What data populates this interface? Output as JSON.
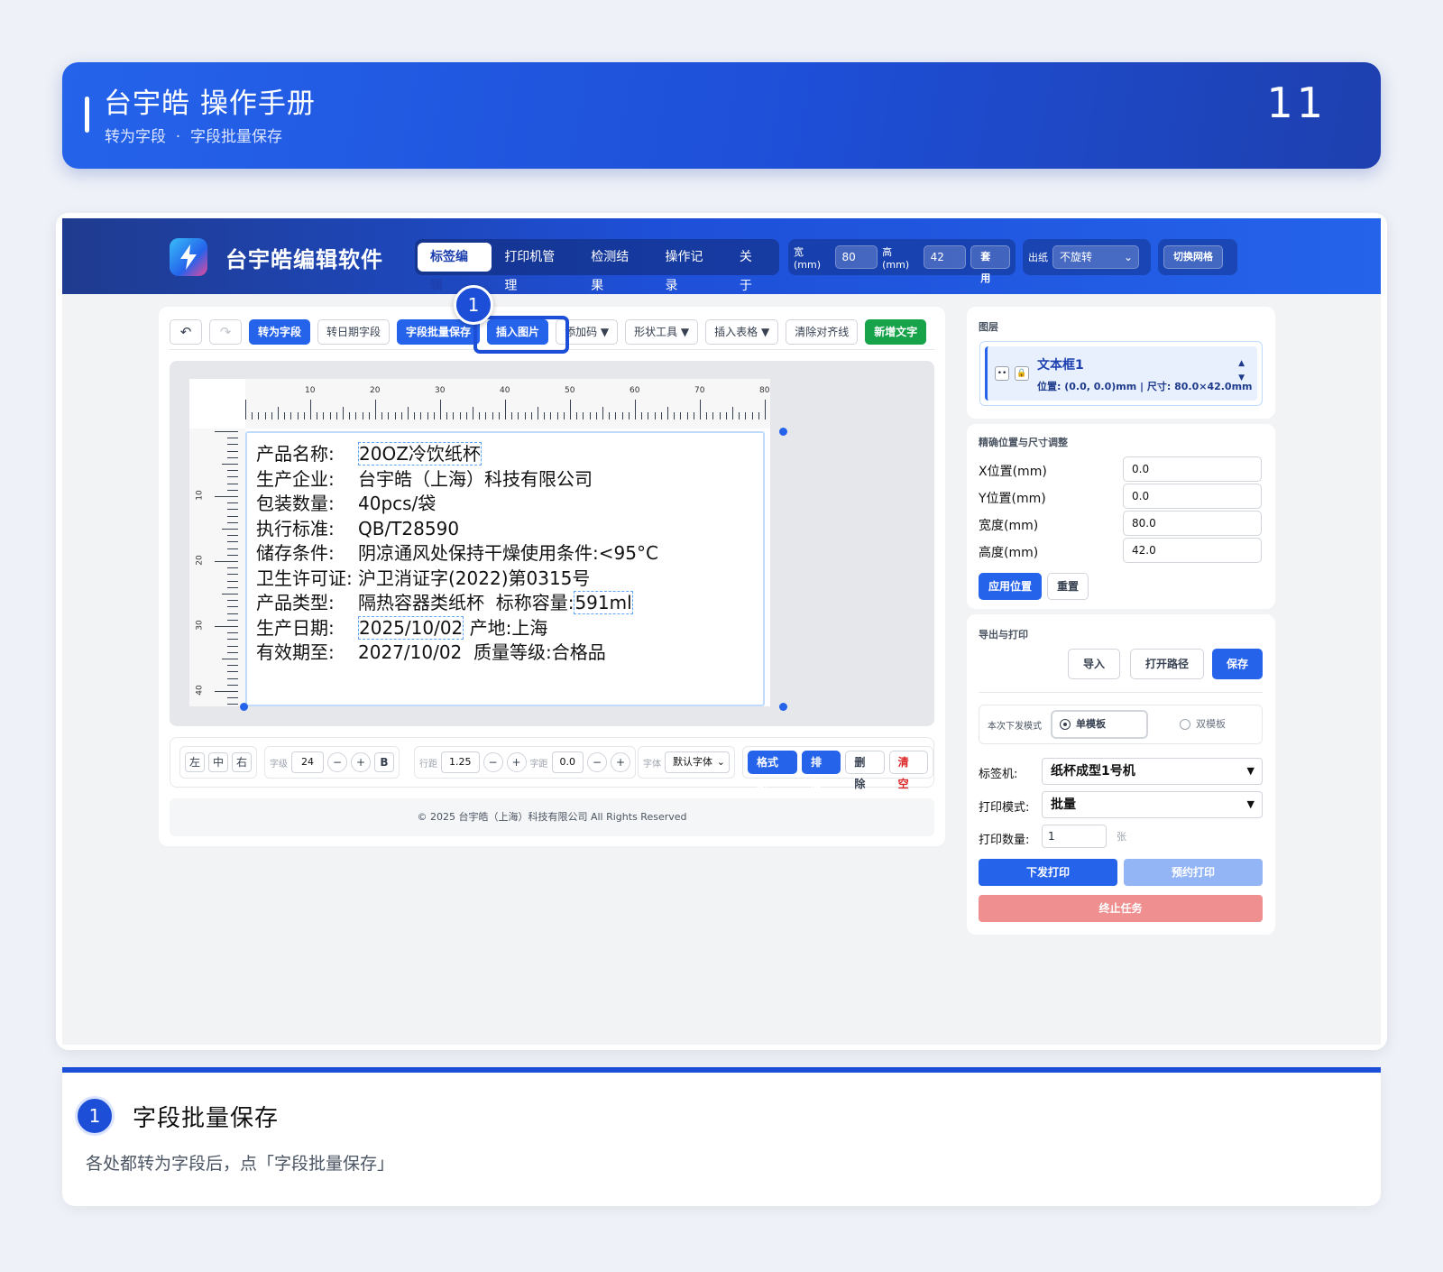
{
  "manual": {
    "title": "台宇皓 操作手册",
    "subtitle": "转为字段  ·  字段批量保存",
    "page_number": "11"
  },
  "app": {
    "name": "台宇皓编辑软件",
    "nav_tabs": [
      "标签编辑",
      "打印机管理",
      "检测结果",
      "操作记录",
      "关于"
    ],
    "active_tab": "标签编辑",
    "size": {
      "width_label": "宽(mm)",
      "width_value": "80",
      "height_label": "高(mm)",
      "height_value": "42",
      "apply_label": "套用"
    },
    "output": {
      "label": "出纸",
      "value": "不旋转"
    },
    "grid_button": "切换网格"
  },
  "toolbar": {
    "undo": "↶",
    "redo": "↷",
    "to_field": "转为字段",
    "to_date_field": "转日期字段",
    "batch_save": "字段批量保存",
    "insert_image": "插入图片",
    "add_code": "添加码 ▼",
    "shape_tools": "形状工具 ▼",
    "insert_table": "插入表格 ▼",
    "clear_guides": "清除对齐线",
    "add_text": "新增文字"
  },
  "callout": {
    "number": "1"
  },
  "ruler": {
    "top_labels": [
      "10",
      "20",
      "30",
      "40",
      "50",
      "60",
      "70",
      "80"
    ],
    "left_labels": [
      "10",
      "20",
      "30",
      "40"
    ]
  },
  "label": {
    "lines": [
      {
        "key": "产品名称:",
        "value": "20OZ冷饮纸杯",
        "field": true
      },
      {
        "key": "生产企业:",
        "value": "台宇皓（上海）科技有限公司"
      },
      {
        "key": "包装数量:",
        "value": "40pcs/袋"
      },
      {
        "key": "执行标准:",
        "value": "QB/T28590"
      },
      {
        "key": "储存条件:",
        "value": "阴凉通风处保持干燥使用条件:<95°C"
      },
      {
        "key": "卫生许可证:",
        "value": "沪卫消证字(2022)第0315号"
      },
      {
        "key": "产品类型:",
        "value": "隔热容器类纸杯  标称容量:",
        "tail": "591ml"
      },
      {
        "key": "生产日期:",
        "value": "2025/10/02",
        "field": true,
        "extra": " 产地:上海"
      },
      {
        "key": "有效期至:",
        "value": "2027/10/02  质量等级:合格品"
      }
    ]
  },
  "format_bar": {
    "align": [
      "左",
      "中",
      "右"
    ],
    "font_size_label": "字级",
    "font_size": "24",
    "minus": "−",
    "plus": "+",
    "bold": "B",
    "line_height_label": "行距",
    "line_height": "1.25",
    "spacing_label": "字距",
    "spacing": "0.0",
    "font_label": "字体",
    "font": "默认字体",
    "format_painter": "格式刷",
    "layout": "排版",
    "delete": "删除",
    "clear": "清空"
  },
  "footer": "© 2025 台宇皓（上海）科技有限公司 All Rights Reserved",
  "layers": {
    "title": "图层",
    "item_name": "文本框1",
    "item_meta": "位置: (0.0, 0.0)mm | 尺寸: 80.0×42.0mm",
    "up": "▲",
    "down": "▼"
  },
  "position": {
    "title": "精确位置与尺寸调整",
    "fields": [
      {
        "label": "X位置(mm)",
        "value": "0.0"
      },
      {
        "label": "Y位置(mm)",
        "value": "0.0"
      },
      {
        "label": "宽度(mm)",
        "value": "80.0"
      },
      {
        "label": "高度(mm)",
        "value": "42.0"
      }
    ],
    "apply": "应用位置",
    "reset": "重置"
  },
  "export": {
    "title": "导出与打印",
    "import": "导入",
    "open_path": "打开路径",
    "save": "保存",
    "mode_label": "本次下发模式",
    "single": "单模板",
    "double": "双模板",
    "machine_label": "标签机:",
    "machine": "纸杯成型1号机",
    "print_mode_label": "打印模式:",
    "print_mode": "批量",
    "qty_label": "打印数量:",
    "qty": "1",
    "qty_unit": "张",
    "send_print": "下发打印",
    "schedule_print": "预约打印",
    "stop_task": "终止任务"
  },
  "note": {
    "number": "1",
    "title": "字段批量保存",
    "description": "各处都转为字段后，点「字段批量保存」"
  },
  "colors": {
    "primary": "#2563eb",
    "dark_primary": "#1d4ed8",
    "green": "#16a34a",
    "danger": "#ef8f8f"
  }
}
